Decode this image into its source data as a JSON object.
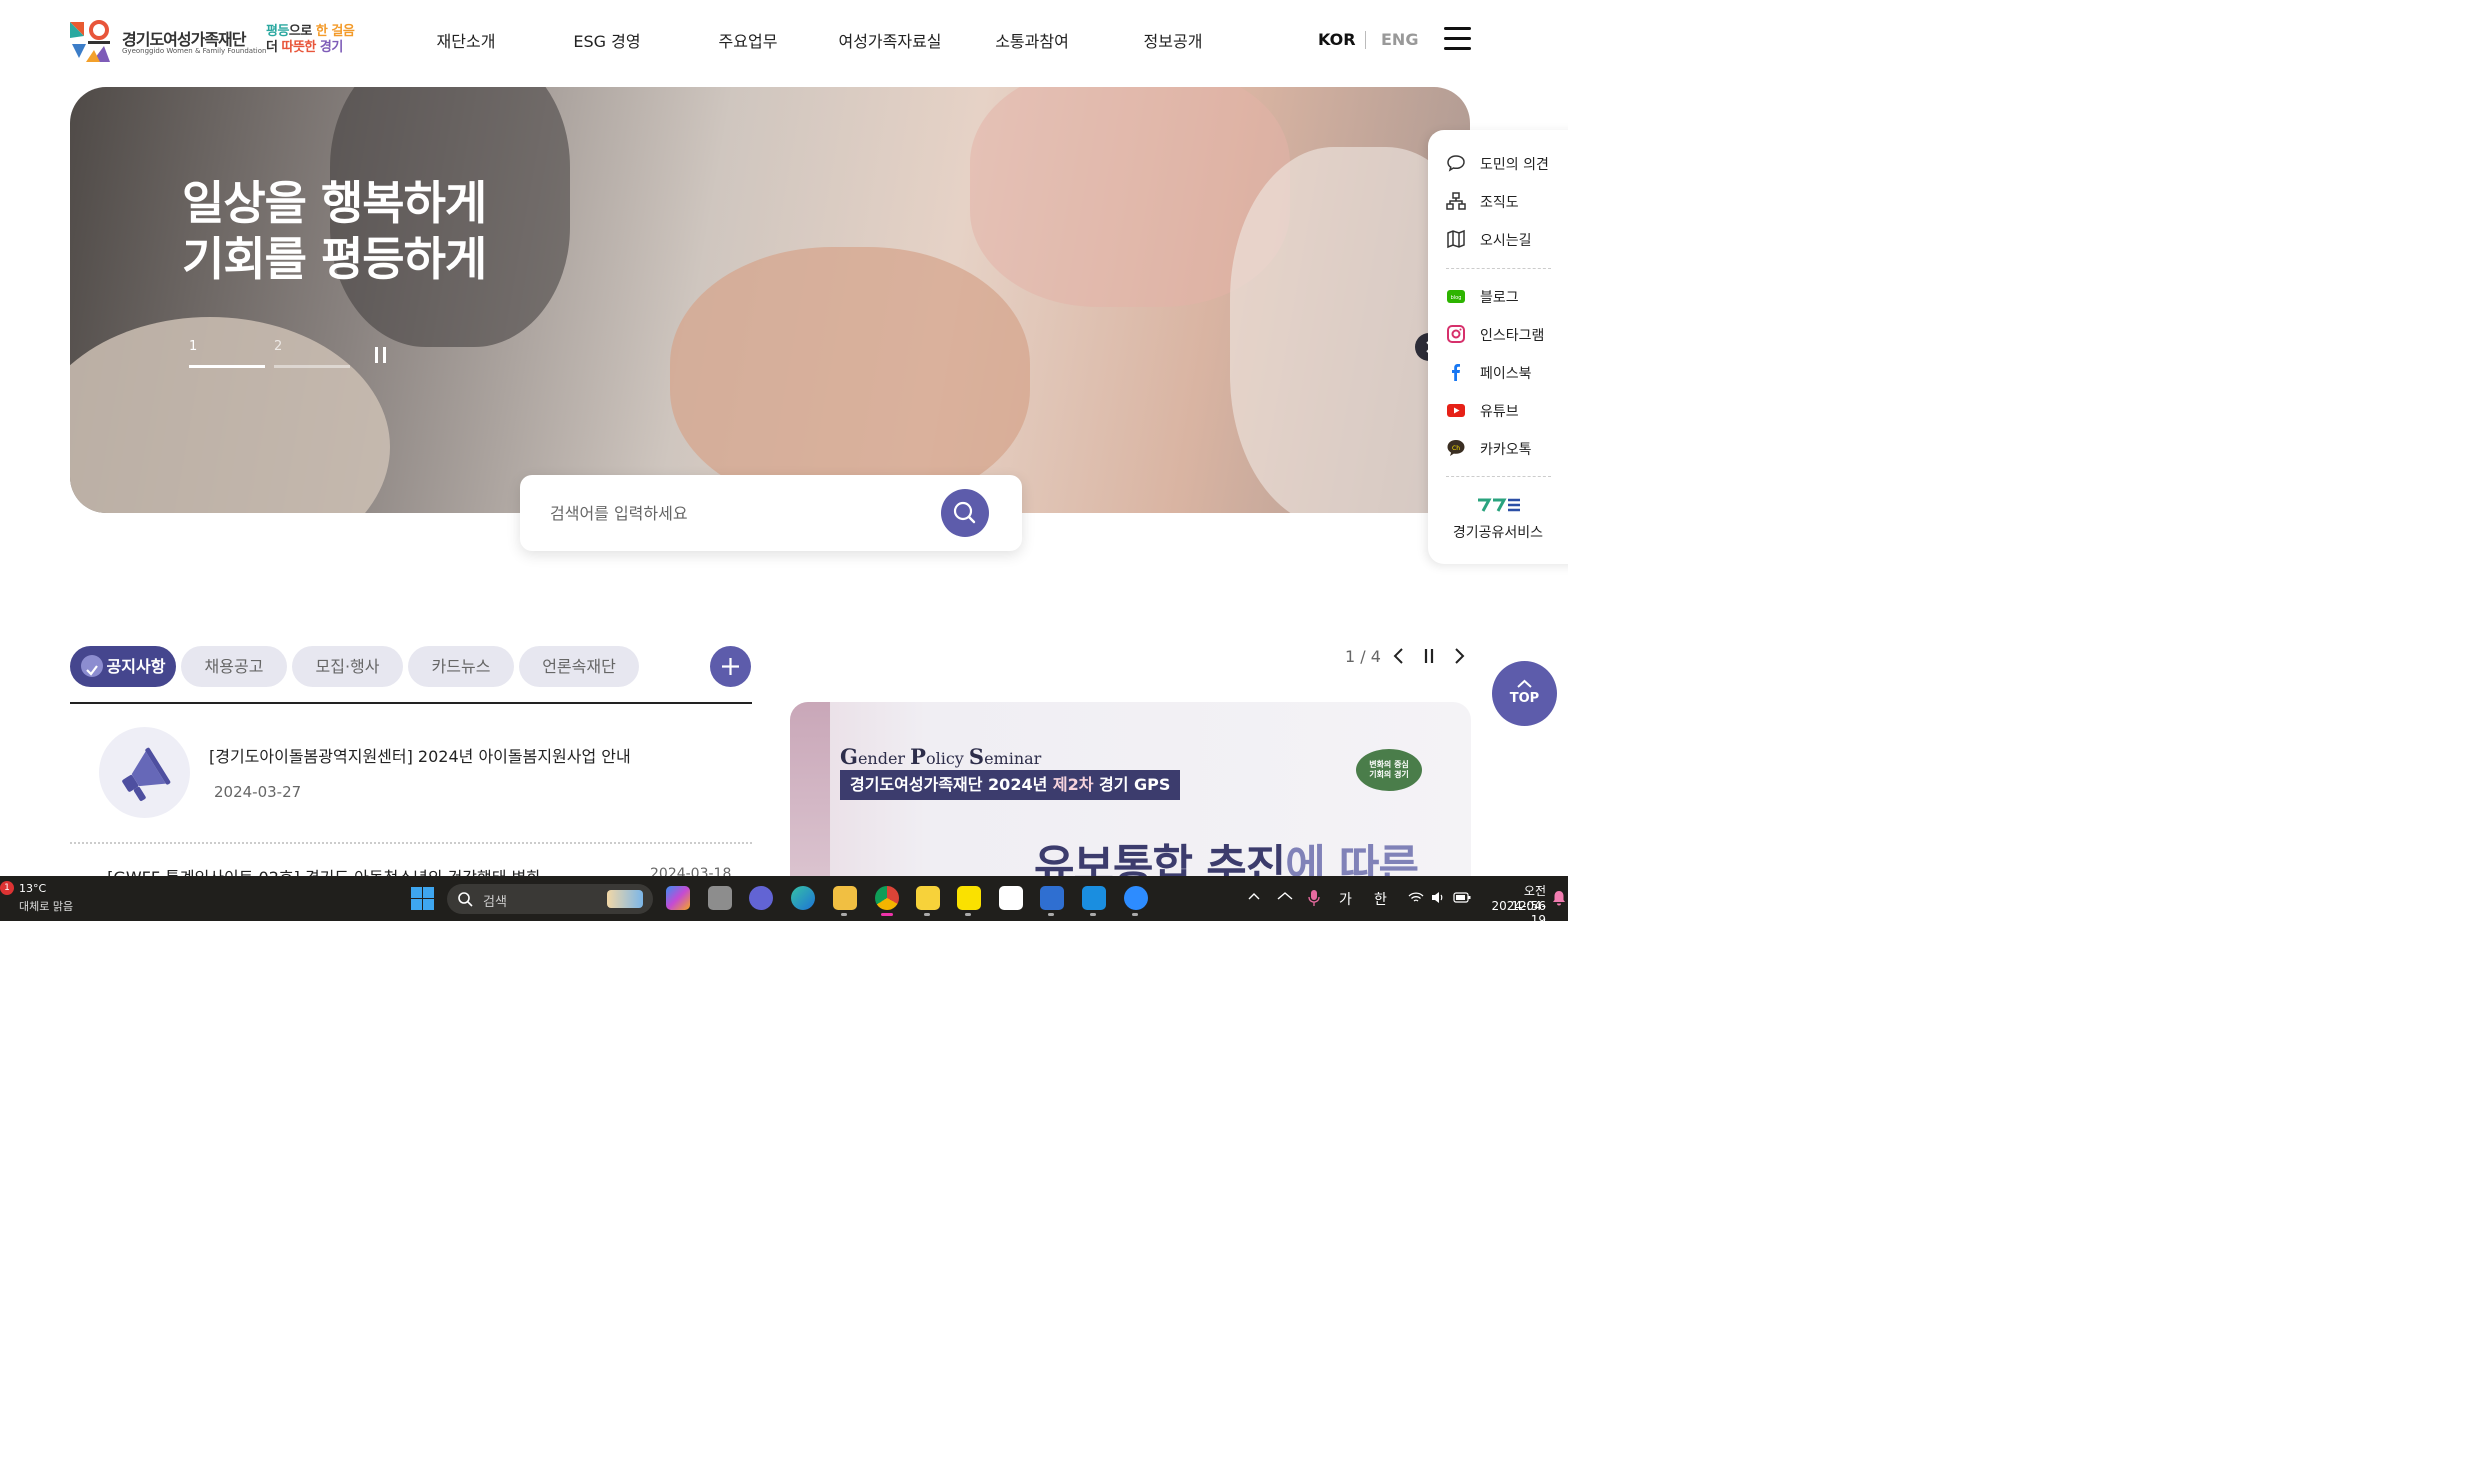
{
  "header": {
    "logo_name": "경기도여성가족재단",
    "logo_eng": "Gyeonggido Women & Family Foundation",
    "slogan_line1_a": "평등",
    "slogan_line1_b": "으로",
    "slogan_line1_c": "한 걸음",
    "slogan_line2_a": "더",
    "slogan_line2_b": "따뜻한",
    "slogan_line2_c": "경기",
    "nav": [
      "재단소개",
      "ESG 경영",
      "주요업무",
      "여성가족자료실",
      "소통과참여",
      "정보공개"
    ],
    "lang_kor": "KOR",
    "lang_eng": "ENG"
  },
  "hero": {
    "title": "일상을 행복하게\n기회를 평등하게",
    "slide1": "1",
    "slide2": "2"
  },
  "search": {
    "placeholder": "검색어를 입력하세요"
  },
  "quick_menu": {
    "items": [
      "도민의 의견",
      "조직도",
      "오시는길",
      "블로그",
      "인스타그램",
      "페이스북",
      "유튜브",
      "카카오톡"
    ],
    "service": "경기공유서비스"
  },
  "board": {
    "tabs": [
      "공지사항",
      "채용공고",
      "모집·행사",
      "카드뉴스",
      "언론속재단"
    ],
    "featured_title": "[경기도아이돌봄광역지원센터] 2024년 아이돌봄지원사업 안내",
    "featured_date": "2024-03-27",
    "second_title": "[GWFF 통계인사이트 02호] 경기도 아동청소년의 건강행태 변화",
    "second_date": "2024-03-18"
  },
  "banner": {
    "pager": "1 / 4",
    "kicker_G": "G",
    "kicker_ender": "ender ",
    "kicker_P": "P",
    "kicker_olicy": "olicy ",
    "kicker_S": "S",
    "kicker_eminar": "eminar",
    "tag_a": "경기도여성가족재단 2024년 ",
    "tag_b": "제2차",
    "tag_c": " 경기 GPS",
    "headline_a": "유보통합 추진",
    "headline_b": "에 따른",
    "badge": "변화의 중심\n기회의 경기",
    "top_label": "TOP"
  },
  "taskbar": {
    "temperature": "13°C",
    "weather": "대체로 맑음",
    "weather_badge": "1",
    "search_label": "검색",
    "ime_a": "가",
    "ime_b": "한",
    "time": "오전 12:56",
    "date": "2024-04-19"
  },
  "colors": {
    "primary": "#5d5cab",
    "tab_active": "#45468e",
    "tab_inactive": "#e7e7f0",
    "banner_dark": "#3c3c6d"
  }
}
